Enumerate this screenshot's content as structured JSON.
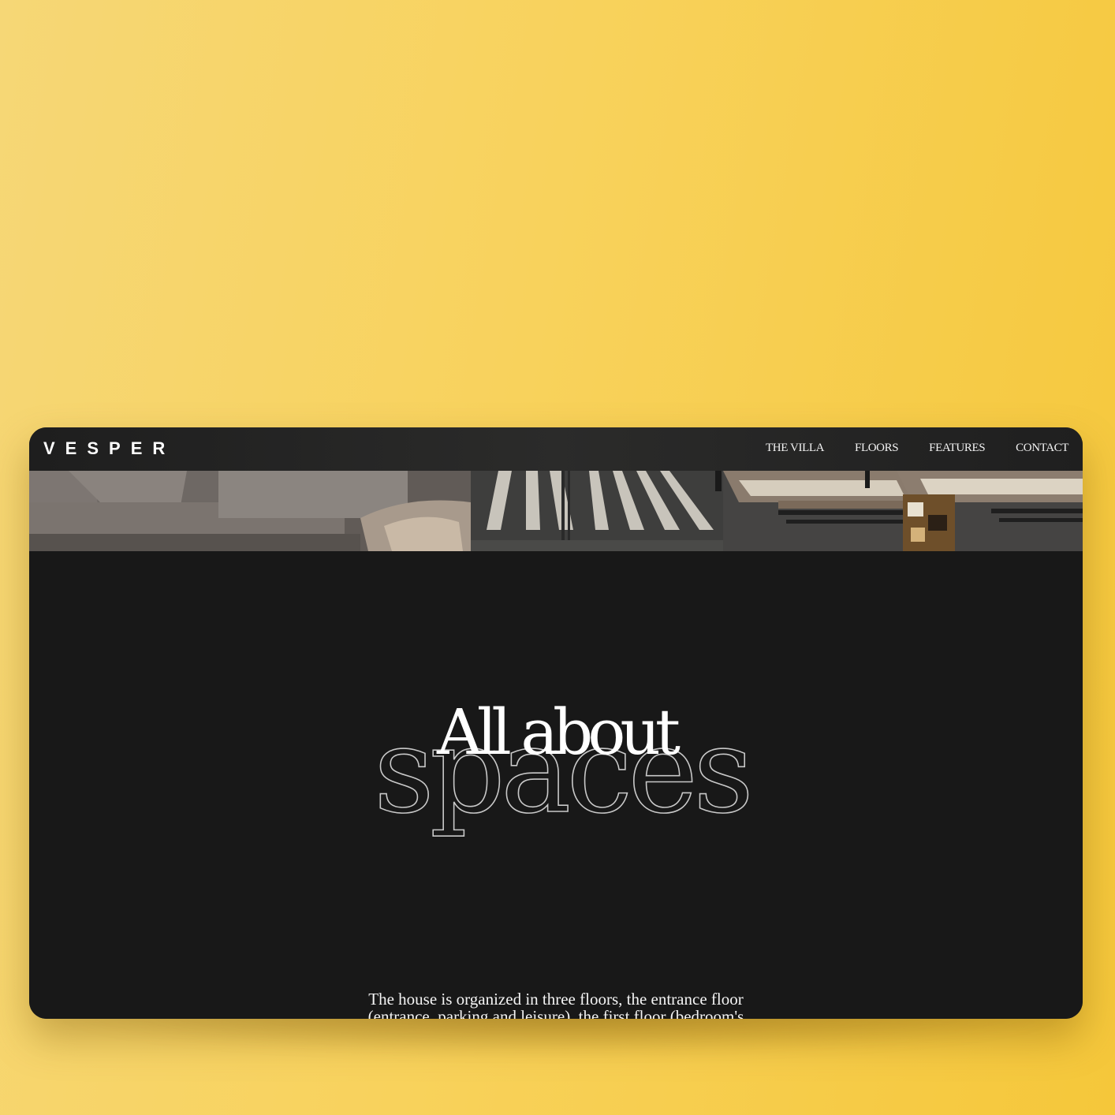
{
  "brand": {
    "logo_text": "VESPER"
  },
  "nav": {
    "items": [
      {
        "label": "THE VILLA"
      },
      {
        "label": "FLOORS"
      },
      {
        "label": "FEATURES"
      },
      {
        "label": "CONTACT"
      }
    ]
  },
  "hero": {
    "title_solid": "All about",
    "title_outline": "spaces",
    "body": "The house is organized in three floors, the entrance floor (entrance, parking and leisure), the first floor (bedroom's floor) and"
  },
  "colors": {
    "backdrop": "#f8d25c",
    "page_bg": "#181818",
    "text": "#ffffff"
  }
}
